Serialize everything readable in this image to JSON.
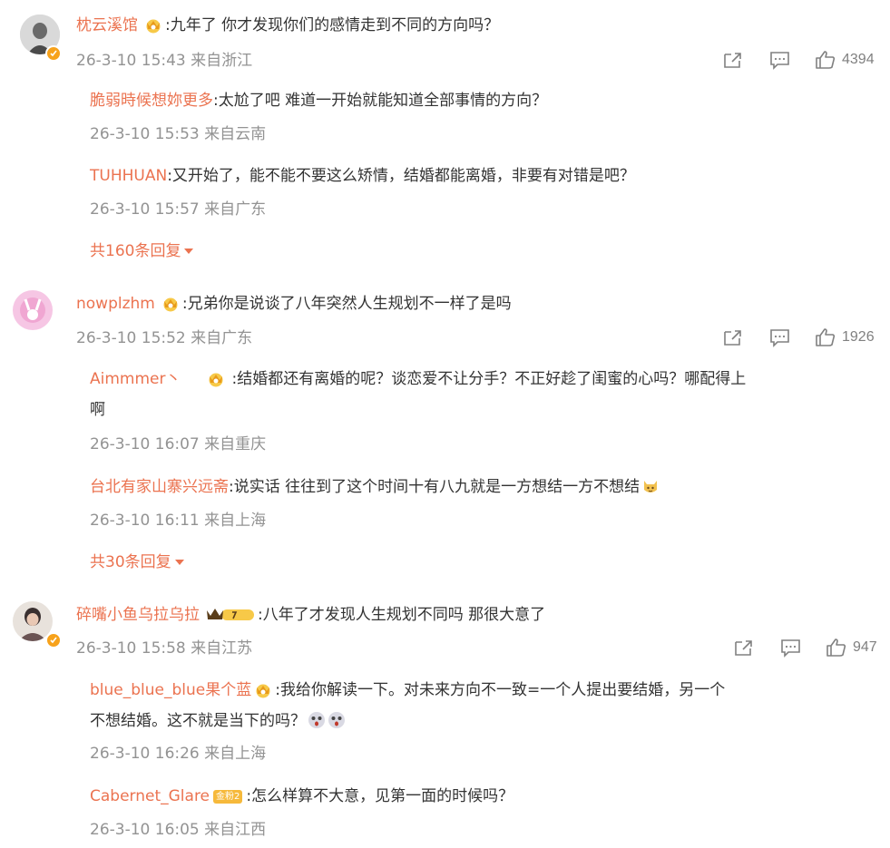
{
  "colors": {
    "name": "#eb7350",
    "meta": "#939393",
    "text": "#333333",
    "icon": "#808080"
  },
  "comments": [
    {
      "user": "枕云溪馆",
      "text": ":九年了 你才发现你们的感情走到不同的方向吗？",
      "meta": "26-3-10 15:43 来自浙江",
      "likes": "4394",
      "replies": [
        {
          "user": "脆弱時候想妳更多",
          "text": ":太尬了吧 难道一开始就能知道全部事情的方向？",
          "meta": "26-3-10 15:53 来自云南"
        },
        {
          "user": "TUHHUAN",
          "text": ":又开始了，能不能不要这么矫情，结婚都能离婚，非要有对错是吧？",
          "meta": "26-3-10 15:57 来自广东"
        }
      ],
      "more": "共160条回复"
    },
    {
      "user": "nowplzhm",
      "text": ":兄弟你是说谈了八年突然人生规划不一样了是吗",
      "meta": "26-3-10 15:52 来自广东",
      "likes": "1926",
      "replies": [
        {
          "user": "Aimmmer丶",
          "text": ":结婚都还有离婚的呢？谈恋爱不让分手？不正好趁了闺蜜的心吗？哪配得上",
          "text2": "啊",
          "meta": "26-3-10 16:07 来自重庆"
        },
        {
          "user": "台北有家山寨兴远斋",
          "text": ":说实话 往往到了这个时间十有八九就是一方想结一方不想结",
          "meta": "26-3-10 16:11 来自上海"
        }
      ],
      "more": "共30条回复"
    },
    {
      "user": "碎嘴小鱼乌拉乌拉",
      "text": ":八年了才发现人生规划不同吗 那很大意了",
      "meta": "26-3-10 15:58 来自江苏",
      "likes": "947",
      "replies": [
        {
          "user": "blue_blue_blue果个蓝",
          "text": ":我给你解读一下。对未来方向不一致=一个人提出要结婚，另一个",
          "text2": "不想结婚。这不就是当下的吗？",
          "meta": "26-3-10 16:26 来自上海"
        },
        {
          "user": "Cabernet_Glare",
          "badge": "金粉2",
          "text": ":怎么样算不大意，见第一面的时候吗？",
          "meta": "26-3-10 16:05 来自江西"
        }
      ]
    }
  ],
  "icons": [
    "share-icon",
    "comment-icon",
    "like-icon",
    "vip-crown-icon",
    "verified-badge-icon"
  ]
}
